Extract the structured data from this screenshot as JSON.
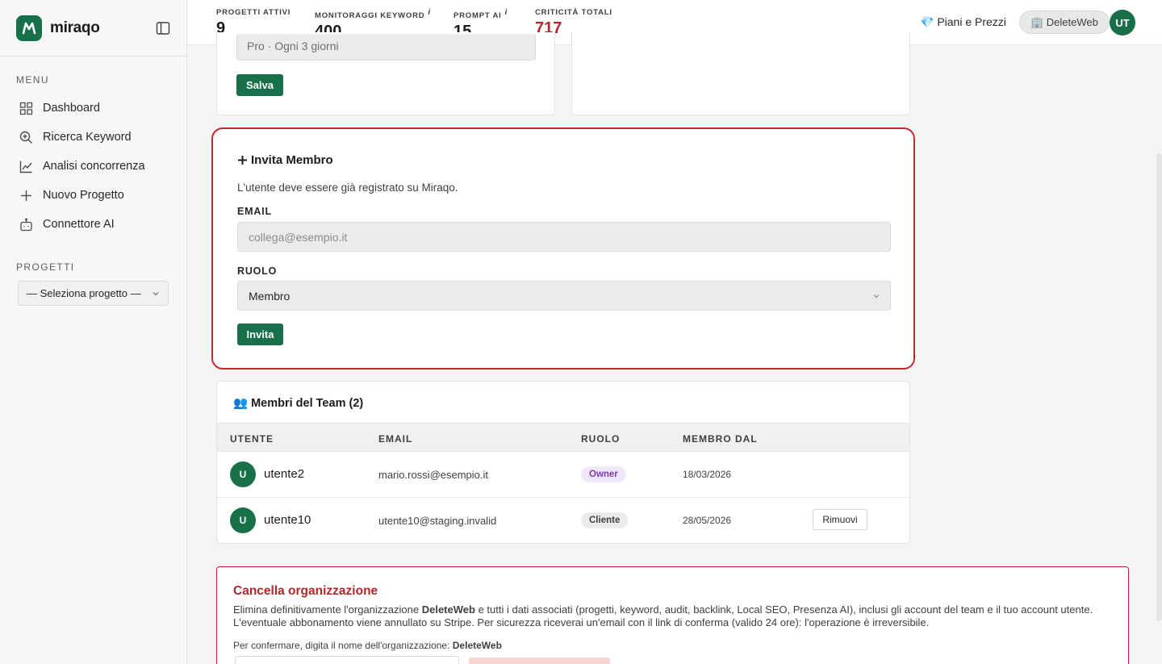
{
  "brand": {
    "name": "miraqo",
    "accent": "#177049"
  },
  "sidebar": {
    "menu_label": "MENU",
    "items": [
      {
        "label": "Dashboard",
        "icon": "grid-icon"
      },
      {
        "label": "Ricerca Keyword",
        "icon": "search-icon"
      },
      {
        "label": "Analisi concorrenza",
        "icon": "line-chart-icon"
      },
      {
        "label": "Nuovo Progetto",
        "icon": "plus-icon"
      },
      {
        "label": "Connettore AI",
        "icon": "robot-icon"
      }
    ],
    "projects_label": "PROGETTI",
    "project_select": "— Seleziona progetto —"
  },
  "topbar": {
    "stats": [
      {
        "label": "PROGETTI ATTIVI",
        "value": "9",
        "info": ""
      },
      {
        "label": "MONITORAGGI KEYWORD",
        "value": "400",
        "info": "i"
      },
      {
        "label": "PROMPT AI",
        "value": "15",
        "info": "i"
      },
      {
        "label": "CRITICITÀ TOTALI",
        "value": "717",
        "info": ""
      }
    ],
    "pricing_link": "💎 Piani e Prezzi",
    "org_pill": "🏢 DeleteWeb",
    "avatar": "UT"
  },
  "settings": {
    "plan_value": "Pro · Ogni 3 giorni",
    "save_label": "Salva"
  },
  "invite": {
    "title": "Invita Membro",
    "description": "L'utente deve essere già registrato su Miraqo.",
    "email_label": "EMAIL",
    "email_placeholder": "collega@esempio.it",
    "role_label": "RUOLO",
    "role_value": "Membro",
    "submit_label": "Invita"
  },
  "team": {
    "title": "👥 Membri del Team (2)",
    "columns": [
      "UTENTE",
      "EMAIL",
      "RUOLO",
      "MEMBRO DAL"
    ],
    "rows": [
      {
        "initial": "U",
        "user": "utente2",
        "email": "mario.rossi@esempio.it",
        "role": "Owner",
        "since": "18/03/2026",
        "action": ""
      },
      {
        "initial": "U",
        "user": "utente10",
        "email": "utente10@staging.invalid",
        "role": "Cliente",
        "since": "28/05/2026",
        "action": "Rimuovi"
      }
    ]
  },
  "danger": {
    "title": "Cancella organizzazione",
    "text_before": "Elimina definitivamente l'organizzazione ",
    "org_name": "DeleteWeb",
    "text_after": " e tutti i dati associati (progetti, keyword, audit, backlink, Local SEO, Presenza AI), inclusi gli account del team e il tuo account utente. L'eventuale abbonamento viene annullato su Stripe. Per sicurezza riceverai un'email con il link di conferma (valido 24 ore): l'operazione è irreversibile.",
    "confirm_prefix": "Per confermare, digita il nome dell'organizzazione: ",
    "confirm_name": "DeleteWeb"
  }
}
